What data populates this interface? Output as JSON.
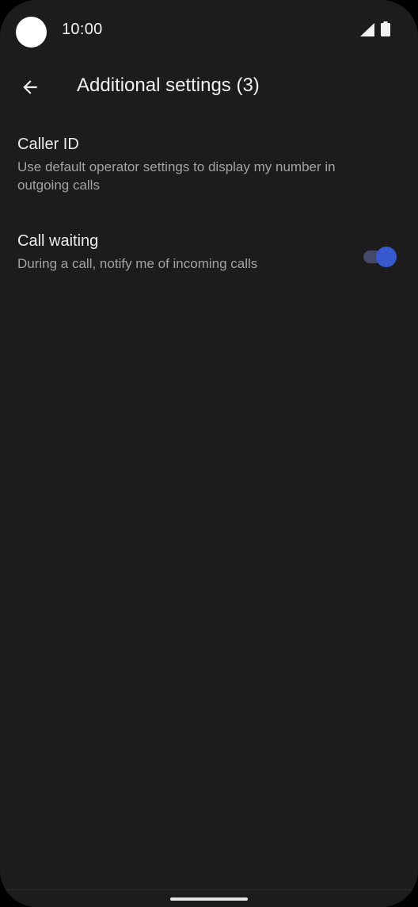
{
  "status_bar": {
    "time": "10:00",
    "signal_icon": "cellular-signal-icon",
    "battery_icon": "battery-full-icon"
  },
  "app_bar": {
    "back_icon": "arrow-back-icon",
    "title": "Additional settings (3)"
  },
  "settings": [
    {
      "title": "Caller ID",
      "summary": "Use default operator settings to display my number in outgoing calls"
    },
    {
      "title": "Call waiting",
      "summary": "During a call, notify me of incoming calls",
      "toggle_on": true
    }
  ],
  "colors": {
    "background": "#1c1c1c",
    "accent": "#3659cf",
    "toggle_track": "#46486a",
    "summary_text": "#a3a3a3"
  }
}
